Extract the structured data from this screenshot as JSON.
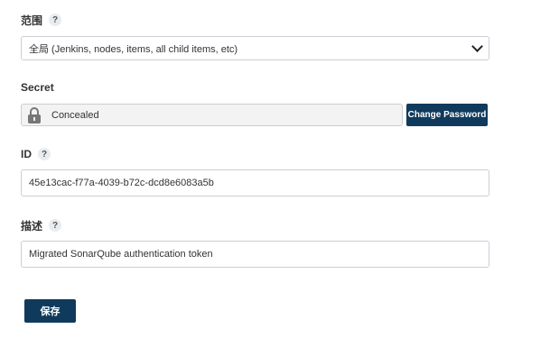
{
  "scope": {
    "label": "范围",
    "help": "?",
    "selected": "全局 (Jenkins, nodes, items, all child items, etc)"
  },
  "secret": {
    "label": "Secret",
    "value": "Concealed",
    "change_button": "Change Password"
  },
  "id_field": {
    "label": "ID",
    "help": "?",
    "value": "45e13cac-f77a-4039-b72c-dcd8e6083a5b"
  },
  "description": {
    "label": "描述",
    "help": "?",
    "value": "Migrated SonarQube authentication token"
  },
  "save_button": "保存",
  "colors": {
    "button_bg": "#0f3a5c",
    "input_border": "#c9cfd6",
    "concealed_bg": "#f3f3f3"
  }
}
